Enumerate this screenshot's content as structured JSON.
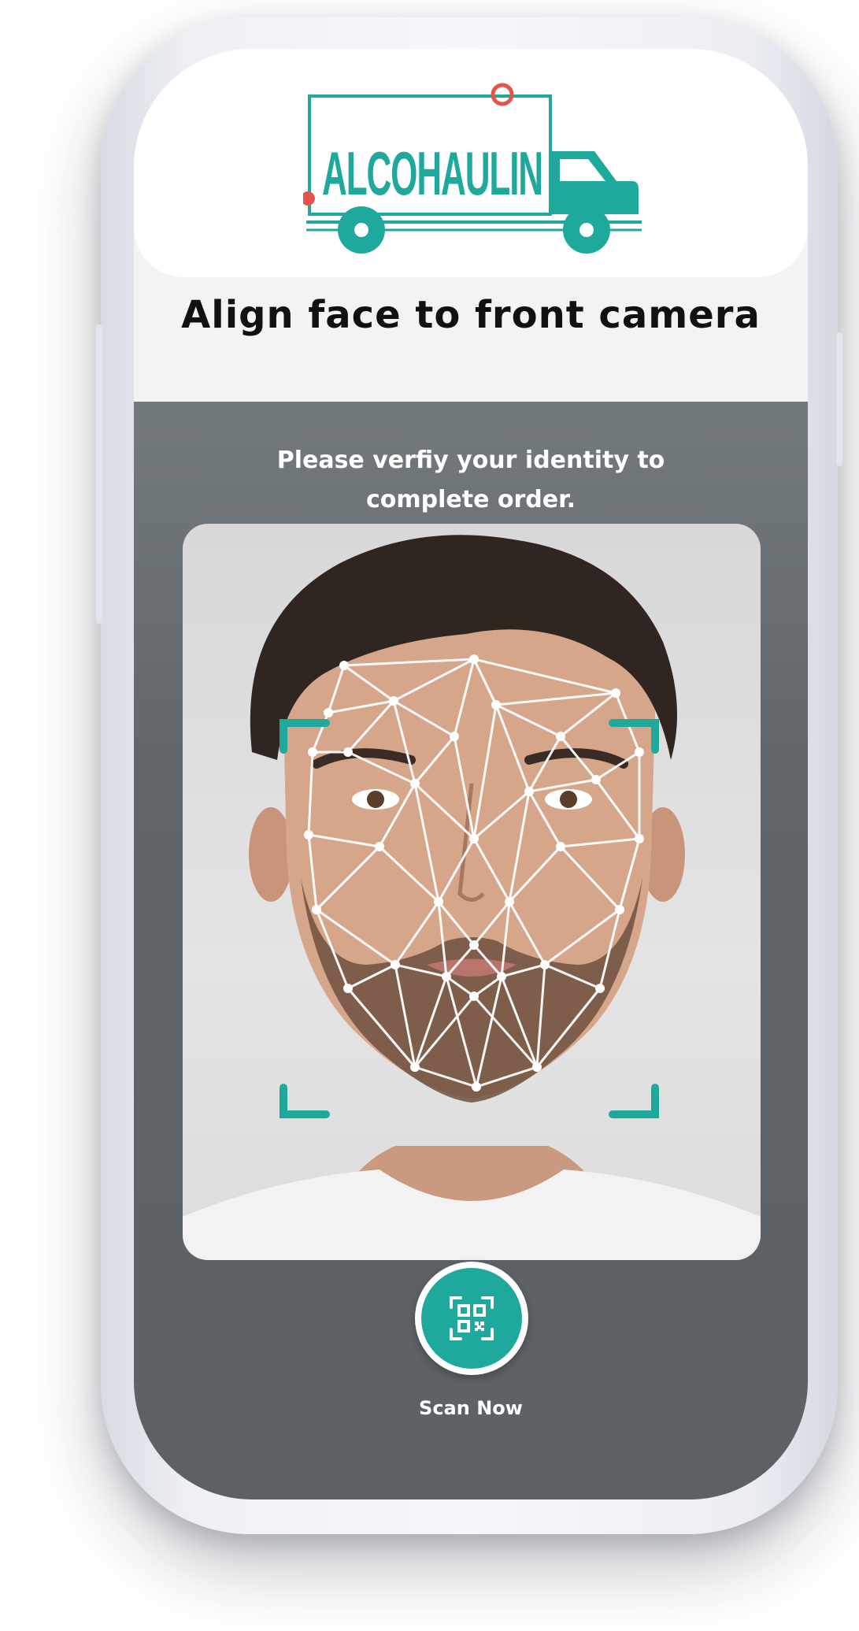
{
  "brand": {
    "logo_text": "ALCOHAULIN",
    "logo_color": "#1fa99c",
    "accent_dot_color": "#e5534b"
  },
  "page": {
    "title": "Align face to front camera"
  },
  "verification": {
    "prompt_line1": "Please verfiy your identity to",
    "prompt_line2": "complete order.",
    "frame_color": "#1fa99c",
    "scan_button_icon": "qr-code-icon",
    "scan_label": "Scan Now"
  },
  "colors": {
    "panel_bg": "#5f6569",
    "accent": "#1fa99c",
    "title_text": "#111111"
  }
}
